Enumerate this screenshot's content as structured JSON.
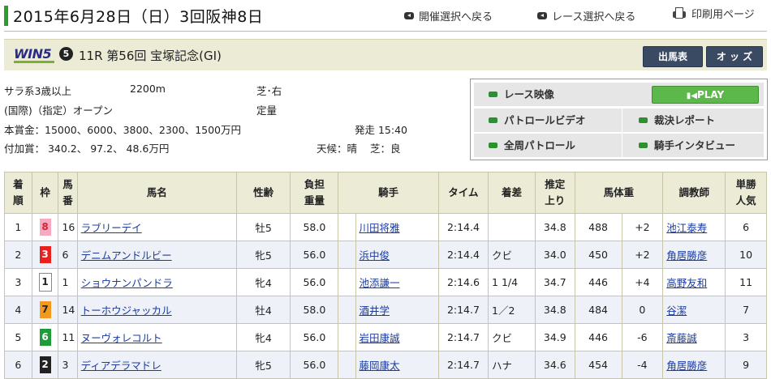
{
  "header": {
    "date": "2015年6月28日（日）3回阪神8日",
    "nav_back_meeting": "開催選択へ戻る",
    "nav_back_race": "レース選択へ戻る",
    "print": "印刷用ページ"
  },
  "race": {
    "win5_logo": "WIN5",
    "win5_leg": "5",
    "title": "11R 第56回 宝塚記念(GI)",
    "btn_entries": "出馬表",
    "btn_odds": "オ ッ ズ"
  },
  "info": {
    "class": "サラ系3歳以上",
    "distance": "2200m",
    "track": "芝･右",
    "conditions": "(国際)（指定）オープン",
    "weight_rule": "定量",
    "prize": "本賞金：15000、6000、3800、2300、1500万円",
    "start_time": "発走 15:40",
    "added_prize": "付加賞：  340.2、 97.2、 48.6万円",
    "weather": "天候：晴",
    "going": "芝：良"
  },
  "video": {
    "race_video": "レース映像",
    "play": "PLAY",
    "patrol": "パトロールビデオ",
    "report": "裁決レポート",
    "full_patrol": "全周パトロール",
    "interview": "騎手インタビュー"
  },
  "table": {
    "headers": {
      "rank": [
        "着",
        "順"
      ],
      "waku": "枠",
      "num": [
        "馬",
        "番"
      ],
      "name": "馬名",
      "sexage": "性齢",
      "weight": [
        "負担",
        "重量"
      ],
      "jockey": "騎手",
      "time": "タイム",
      "margin": "着差",
      "last3f": [
        "推定",
        "上り"
      ],
      "bodyweight": "馬体重",
      "trainer": "調教師",
      "pop": [
        "単勝",
        "人気"
      ]
    },
    "rows": [
      {
        "rank": "1",
        "waku": "8",
        "num": "16",
        "name": "ラブリーデイ",
        "sexage": "牡5",
        "wt": "58.0",
        "jockey": "川田将雅",
        "time": "2:14.4",
        "margin": "",
        "last3f": "34.8",
        "bw": "488",
        "bwdiff": "+2",
        "trainer": "池江泰寿",
        "pop": "6"
      },
      {
        "rank": "2",
        "waku": "3",
        "num": "6",
        "name": "デニムアンドルビー",
        "sexage": "牝5",
        "wt": "56.0",
        "jockey": "浜中俊",
        "time": "2:14.4",
        "margin": "クビ",
        "last3f": "34.0",
        "bw": "450",
        "bwdiff": "+2",
        "trainer": "角居勝彦",
        "pop": "10"
      },
      {
        "rank": "3",
        "waku": "1",
        "num": "1",
        "name": "ショウナンパンドラ",
        "sexage": "牝4",
        "wt": "56.0",
        "jockey": "池添謙一",
        "time": "2:14.6",
        "margin": "1 1/4",
        "last3f": "34.7",
        "bw": "446",
        "bwdiff": "+4",
        "trainer": "高野友和",
        "pop": "11"
      },
      {
        "rank": "4",
        "waku": "7",
        "num": "14",
        "name": "トーホウジャッカル",
        "sexage": "牡4",
        "wt": "58.0",
        "jockey": "酒井学",
        "time": "2:14.7",
        "margin": "1／2",
        "last3f": "34.8",
        "bw": "484",
        "bwdiff": "0",
        "trainer": "谷潔",
        "pop": "7"
      },
      {
        "rank": "5",
        "waku": "6",
        "num": "11",
        "name": "ヌーヴォレコルト",
        "sexage": "牝4",
        "wt": "56.0",
        "jockey": "岩田康誠",
        "time": "2:14.7",
        "margin": "クビ",
        "last3f": "34.9",
        "bw": "446",
        "bwdiff": "-6",
        "trainer": "斎藤誠",
        "pop": "3"
      },
      {
        "rank": "6",
        "waku": "2",
        "num": "3",
        "name": "ディアデラマドレ",
        "sexage": "牝5",
        "wt": "56.0",
        "jockey": "藤岡康太",
        "time": "2:14.7",
        "margin": "ハナ",
        "last3f": "34.6",
        "bw": "454",
        "bwdiff": "-4",
        "trainer": "角居勝彦",
        "pop": "9"
      }
    ]
  },
  "colors": {
    "waku1": "#ffffff",
    "waku2": "#222222",
    "waku3": "#e8211f",
    "waku4": "#1f5bd9",
    "waku5": "#f5d900",
    "waku6": "#1e9a3a",
    "waku7": "#f39a1e",
    "waku8": "#f7a9c0"
  }
}
